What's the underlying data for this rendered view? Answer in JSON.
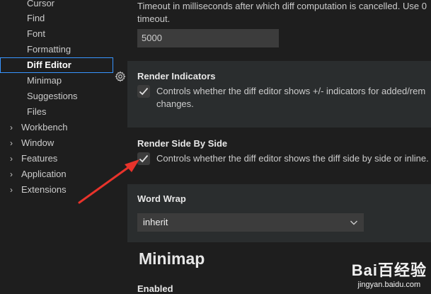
{
  "sidebar": {
    "items": [
      {
        "label": "Cursor"
      },
      {
        "label": "Find"
      },
      {
        "label": "Font"
      },
      {
        "label": "Formatting"
      },
      {
        "label": "Diff Editor"
      },
      {
        "label": "Minimap"
      },
      {
        "label": "Suggestions"
      },
      {
        "label": "Files"
      }
    ],
    "groups": [
      {
        "label": "Workbench"
      },
      {
        "label": "Window"
      },
      {
        "label": "Features"
      },
      {
        "label": "Application"
      },
      {
        "label": "Extensions"
      }
    ]
  },
  "settings": {
    "max_computation": {
      "desc_line1": "Timeout in milliseconds after which diff computation is cancelled. Use 0",
      "desc_line2": "timeout.",
      "value": "5000"
    },
    "render_indicators": {
      "title": "Render Indicators",
      "desc_line1": "Controls whether the diff editor shows +/- indicators for added/rem",
      "desc_line2": "changes.",
      "checked": true
    },
    "render_side_by_side": {
      "title": "Render Side By Side",
      "desc": "Controls whether the diff editor shows the diff side by side or inline.",
      "checked": true
    },
    "word_wrap": {
      "title": "Word Wrap",
      "value": "inherit"
    }
  },
  "section": {
    "minimap_title": "Minimap",
    "enabled_title": "Enabled"
  },
  "watermark": {
    "brand": "Bai百经验",
    "url": "jingyan.baidu.com"
  },
  "colors": {
    "accent": "#3794ff",
    "arrow": "#e8332b",
    "background": "#1e1e1e"
  }
}
